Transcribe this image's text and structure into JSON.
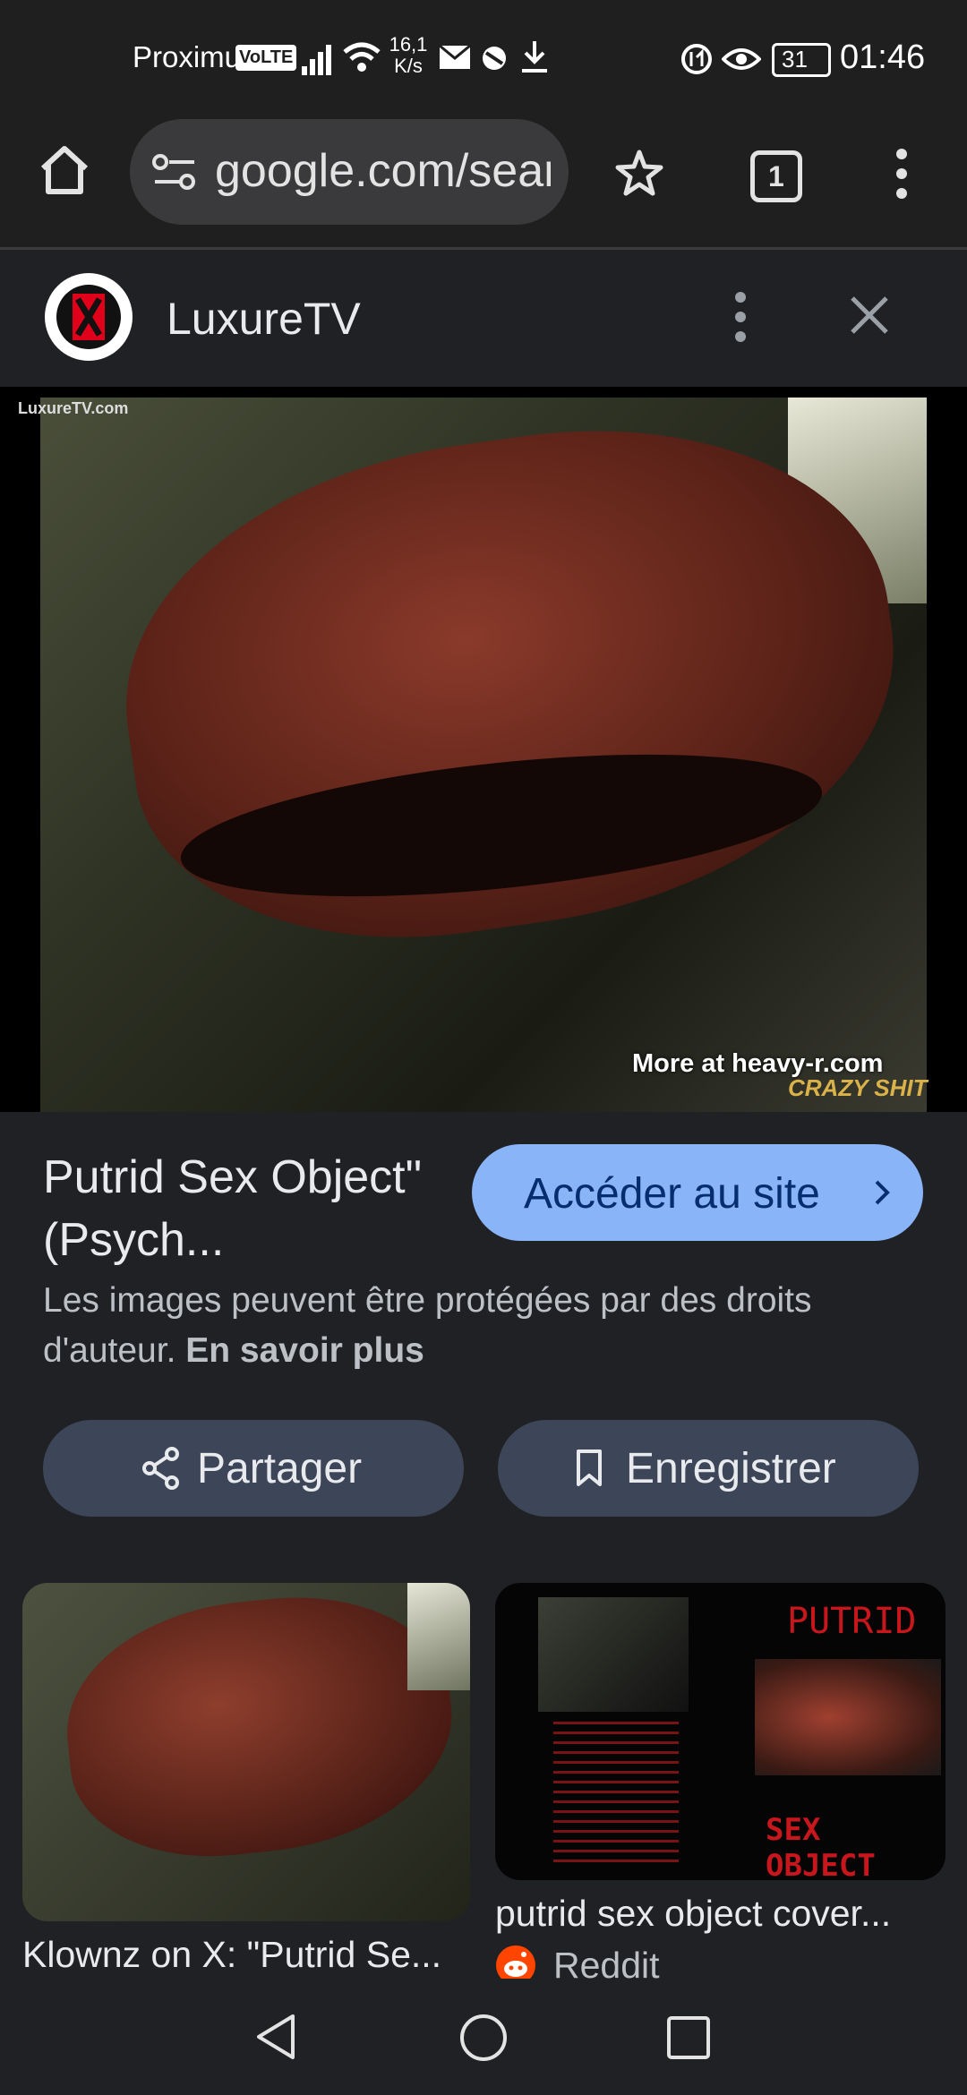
{
  "status_bar": {
    "carrier": "Proximus",
    "volte": "VoLTE",
    "net_speed_top": "16,1",
    "net_speed_bottom": "K/s",
    "battery": "31",
    "time": "01:46"
  },
  "browser": {
    "url": "google.com/sear",
    "tab_count": "1",
    "icons": [
      "home-icon",
      "site-settings-icon",
      "bookmark-star-icon",
      "tabs-icon",
      "more-vert-icon"
    ]
  },
  "panel": {
    "site_name": "LuxureTV",
    "hero_watermark_tl": "LuxureTV.com",
    "hero_watermark_br": "More at heavy-r.com",
    "hero_overlay_logo": "CRAZY SHIT",
    "title": "Putrid Sex Object\" (Psych...",
    "visit_label": "Accéder au site",
    "copyright_text": "Les images peuvent être protégées par des droits d'auteur.",
    "learn_more": "En savoir plus",
    "share_label": "Partager",
    "save_label": "Enregistrer"
  },
  "related": [
    {
      "caption": "Klownz on X: \"Putrid Se...",
      "source": ""
    },
    {
      "caption": "putrid sex object cover...",
      "source": "Reddit",
      "cover_title_top": "PUTRID",
      "cover_title_bottom": "SEX OBJECT"
    }
  ],
  "colors": {
    "background": "#202124",
    "accent_button": "#8ab4f8",
    "pill_button": "#3c4658",
    "reddit": "#ff4500"
  }
}
